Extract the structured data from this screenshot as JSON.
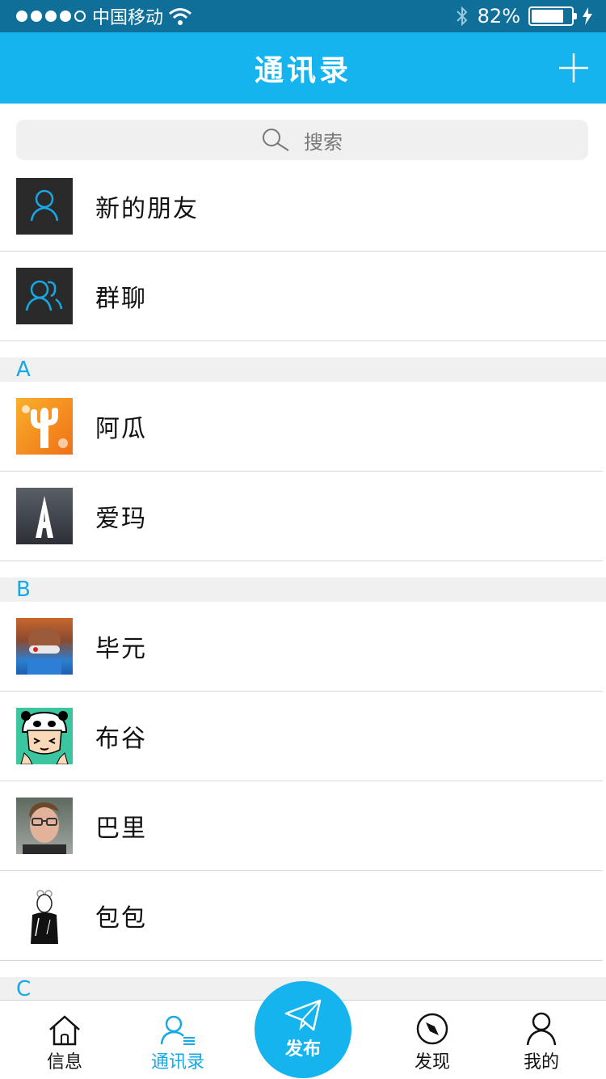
{
  "status_bar": {
    "carrier": "中国移动",
    "battery_text": "82%",
    "battery_level": 0.82
  },
  "header": {
    "title": "通讯录"
  },
  "search": {
    "placeholder": "搜索"
  },
  "top_items": [
    {
      "label": "新的朋友",
      "icon": "new-friend-icon"
    },
    {
      "label": "群聊",
      "icon": "group-chat-icon"
    }
  ],
  "sections": [
    {
      "letter": "A",
      "contacts": [
        {
          "name": "阿瓜"
        },
        {
          "name": "爱玛"
        }
      ]
    },
    {
      "letter": "B",
      "contacts": [
        {
          "name": "毕元"
        },
        {
          "name": "布谷"
        },
        {
          "name": "巴里"
        },
        {
          "name": "包包"
        }
      ]
    },
    {
      "letter": "C",
      "contacts": []
    }
  ],
  "tabbar": {
    "items": [
      {
        "label": "信息",
        "icon": "home-icon"
      },
      {
        "label": "通讯录",
        "icon": "contacts-icon"
      },
      {
        "label": "发布",
        "icon": "paper-plane-icon"
      },
      {
        "label": "发现",
        "icon": "compass-icon"
      },
      {
        "label": "我的",
        "icon": "profile-icon"
      }
    ],
    "active": "通讯录"
  },
  "colors": {
    "accent": "#15b4ee",
    "status_bar": "#0f6f99",
    "section_letter": "#15a9e6"
  }
}
